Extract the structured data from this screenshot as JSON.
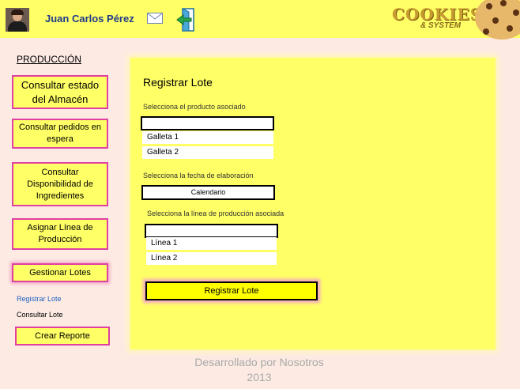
{
  "header": {
    "user_name": "Juan Carlos Pérez",
    "logo_title": "COOKIES",
    "logo_subtitle": "& SYSTEM",
    "icons": {
      "avatar": "user-avatar",
      "mail": "mail-icon",
      "logout": "exit-door-icon",
      "cookie": "cookie-logo-icon"
    }
  },
  "sidebar": {
    "section_title": "PRODUCCIÓN",
    "buttons": [
      "Consultar estado del Almacén",
      "Consultar pedidos en espera",
      "Consultar Disponibilidad de Ingredientes",
      "Asignar Línea de Producción",
      "Gestionar Lotes"
    ],
    "sub_links": [
      "Registrar Lote",
      "Consultar Lote"
    ],
    "report_button": "Crear Reporte",
    "active_button": "Gestionar Lotes",
    "current_link": "Registrar Lote"
  },
  "form": {
    "title": "Registrar Lote",
    "product_label": "Selecciona el producto asociado",
    "product_value": "",
    "product_options": [
      "Galleta 1",
      "Galleta 2"
    ],
    "date_label": "Selecciona la fecha de elaboración",
    "calendar_button": "Calendario",
    "line_label": "Selecciona la línea de producción asociada",
    "line_value": "",
    "line_options": [
      "Línea 1",
      "Línea 2"
    ],
    "submit_label": "Registrar Lote"
  },
  "footer": {
    "line1": "Desarrollado por Nosotros",
    "line2": "2013"
  },
  "colors": {
    "header_bg": "#ffff66",
    "page_bg": "#fdebe3",
    "accent_border": "#e040a0",
    "link_blue": "#1f5fbf"
  }
}
